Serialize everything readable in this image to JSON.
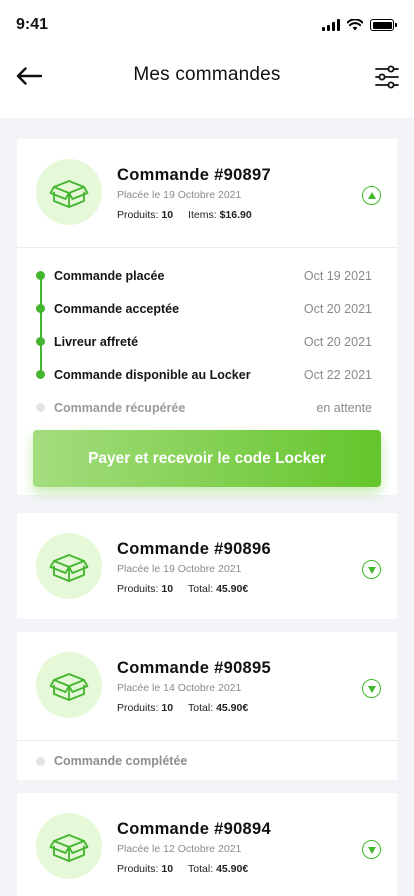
{
  "status_bar": {
    "time": "9:41"
  },
  "header": {
    "title": "Mes commandes"
  },
  "orders": [
    {
      "title": "Commande #90897",
      "date": "Placée le 19 Octobre 2021",
      "products_label": "Produits:",
      "products_count": "10",
      "total_label": "Items:",
      "total_value": "$16.90",
      "expanded": true,
      "steps": [
        {
          "label": "Commande placée",
          "date": "Oct 19 2021",
          "done": true
        },
        {
          "label": "Commande acceptée",
          "date": "Oct 20 2021",
          "done": true
        },
        {
          "label": "Livreur affreté",
          "date": "Oct 20 2021",
          "done": true
        },
        {
          "label": "Commande disponible au Locker",
          "date": "Oct 22 2021",
          "done": true
        },
        {
          "label": "Commande récupérée",
          "date": "en attente",
          "done": false
        }
      ],
      "action_label": "Payer et recevoir le code Locker"
    },
    {
      "title": "Commande #90896",
      "date": "Placée le 19 Octobre 2021",
      "products_label": "Produits:",
      "products_count": "10",
      "total_label": "Total:",
      "total_value": "45.90€",
      "expanded": false
    },
    {
      "title": "Commande #90895",
      "date": "Placée le 14 Octobre 2021",
      "products_label": "Produits:",
      "products_count": "10",
      "total_label": "Total:",
      "total_value": "45.90€",
      "expanded": false,
      "status": "Commande complétée"
    },
    {
      "title": "Commande #90894",
      "date": "Placée le 12 Octobre 2021",
      "products_label": "Produits:",
      "products_count": "10",
      "total_label": "Total:",
      "total_value": "45.90€",
      "expanded": false
    }
  ],
  "colors": {
    "accent": "#43b52e",
    "box_bg": "#e5f8d7",
    "page_bg": "#f3f4f8"
  }
}
